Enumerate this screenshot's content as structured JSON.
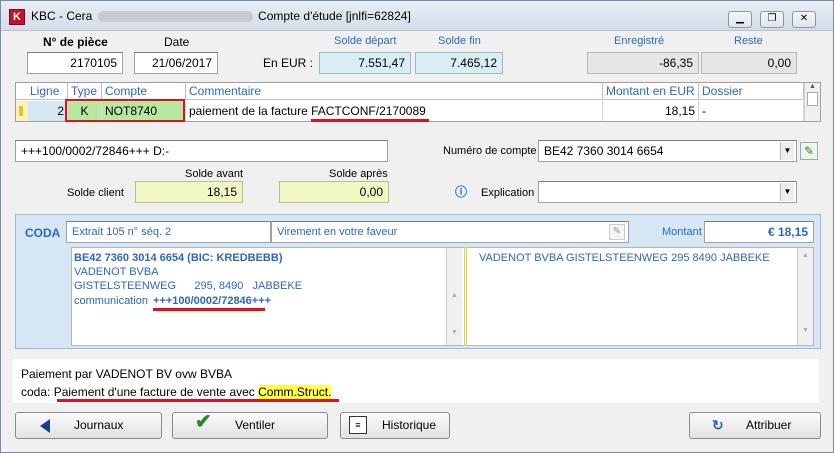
{
  "window": {
    "title_prefix": "KBC - Cera",
    "title_suffix": "Compte d'étude [jnlfi=62824]",
    "app_icon": "kbc-logo-icon",
    "controls": [
      "minimize",
      "restore",
      "close"
    ]
  },
  "header": {
    "piece_label": "N° de pièce",
    "piece_value": "2170105",
    "date_label": "Date",
    "date_value": "21/06/2017",
    "currency_label": "En EUR :",
    "solde_depart_label": "Solde départ",
    "solde_depart_value": "7.551,47",
    "solde_fin_label": "Solde fin",
    "solde_fin_value": "7.465,12",
    "enregistre_label": "Enregistré",
    "enregistre_value": "-86,35",
    "reste_label": "Reste",
    "reste_value": "0,00"
  },
  "grid": {
    "columns": [
      "Ligne",
      "Type",
      "Compte",
      "Commentaire",
      "Montant en EUR",
      "Dossier"
    ],
    "rows": [
      {
        "ligne": "2",
        "type": "K",
        "compte": "NOT8740",
        "commentaire_prefix": "paiement de la facture ",
        "commentaire_ref": "FACTCONF/2170089",
        "montant": "18,15",
        "dossier": "-"
      }
    ]
  },
  "details": {
    "communication": "+++100/0002/72846+++  D:-",
    "numero_compte_label": "Numéro de compte",
    "numero_compte_value": "BE42 7360 3014 6654",
    "solde_avant_label": "Solde avant",
    "solde_apres_label": "Solde après",
    "solde_client_label": "Solde client",
    "solde_avant_value": "18,15",
    "solde_apres_value": "0,00",
    "explication_label": "Explication",
    "explication_value": ""
  },
  "coda": {
    "label": "CODA",
    "extrait": "Extrait 105  n° séq. 2",
    "type_text": "Virement en votre faveur",
    "montant_label": "Montant",
    "montant_value": "€ 18,15",
    "lines": [
      "BE42 7360 3014 6654 (BIC: KREDBEBB)",
      "VADENOT BVBA",
      "GISTELSTEENWEG      295, 8490   JABBEKE"
    ],
    "communication_label": "communication",
    "communication_value": "+++100/0002/72846+++",
    "right_text": "VADENOT BVBA  GISTELSTEENWEG 295  8490 JABBEKE"
  },
  "info": {
    "line1": "Paiement par VADENOT BV ovw BVBA",
    "line2_prefix": "coda: ",
    "line2_text": "Paiement d'une facture de vente avec ",
    "line2_highlight": "Comm.Struct."
  },
  "buttons": {
    "journaux": "Journaux",
    "ventiler": "Ventiler",
    "historique": "Historique",
    "attribuer": "Attribuer"
  },
  "colors": {
    "accent_blue": "#2d68b8",
    "grid_green": "#b6e8a0",
    "highlight_red": "#e01020",
    "yellow_field": "#f2f5c4",
    "coda_bg": "#d6e6f5"
  }
}
